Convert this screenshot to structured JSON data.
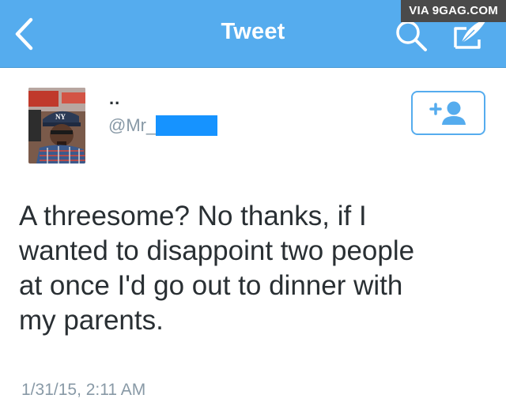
{
  "watermark": "VIA 9GAG.COM",
  "navbar": {
    "title": "Tweet",
    "background_color": "#55acee",
    "back_icon": "chevron-left-icon",
    "search_icon": "search-icon",
    "compose_icon": "compose-quill-icon"
  },
  "profile": {
    "display_name": "..",
    "handle": "@Mr_",
    "handle_redacted": true,
    "redaction_color": "#1693ff",
    "follow_icon": "add-person-icon"
  },
  "tweet": {
    "text": "A threesome? No thanks, if I wanted to disappoint two people at once I'd go out to dinner with my parents.",
    "lines": [
      "A threesome? No thanks, if I",
      "wanted to disappoint two people",
      "at once I'd go out to dinner with",
      "my parents."
    ],
    "timestamp": "1/31/15, 2:11 AM"
  }
}
